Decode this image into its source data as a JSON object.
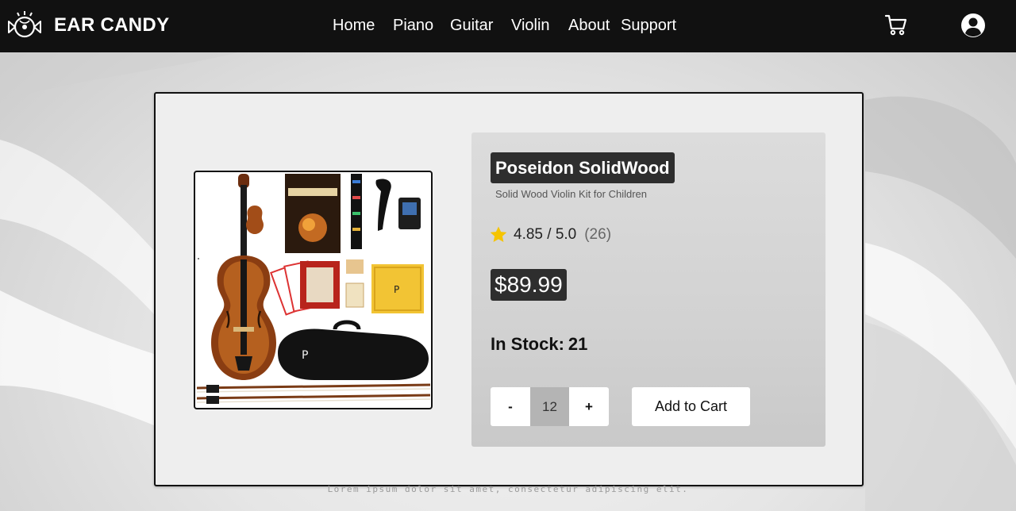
{
  "brand": {
    "name": "EAR CANDY"
  },
  "nav": {
    "links": [
      {
        "label": "Home"
      },
      {
        "label": "Piano"
      },
      {
        "label": "Guitar"
      },
      {
        "label": "Violin"
      },
      {
        "label": "About"
      },
      {
        "label": "Support"
      }
    ],
    "icons": {
      "logo": "candy-disc-logo-icon",
      "cart": "shopping-cart-icon",
      "account": "user-account-icon"
    }
  },
  "product": {
    "title": "Poseidon SolidWood",
    "subtitle": "Solid Wood Violin Kit for Children",
    "rating": "4.85 / 5.0",
    "rating_count": "(26)",
    "rating_icon": "star-icon",
    "price": "$89.99",
    "stock_label": "In Stock:",
    "stock_value": "21",
    "quantity": "12",
    "qty_minus_label": "-",
    "qty_plus_label": "+",
    "add_to_cart_label": "Add to Cart",
    "image_label": "Poseidon violin kit product photo"
  },
  "footer": {
    "text": "Lorem ipsum dolor sit amet, consectetur adipiscing elit."
  },
  "colors": {
    "navbar_bg": "#111111",
    "card_bg": "#eeeeee",
    "panel_bg": "#d2d2d2",
    "label_dark_bg": "#2e2e2e",
    "star": "#f5c400",
    "qty_field_bg": "#b4b4b4"
  }
}
